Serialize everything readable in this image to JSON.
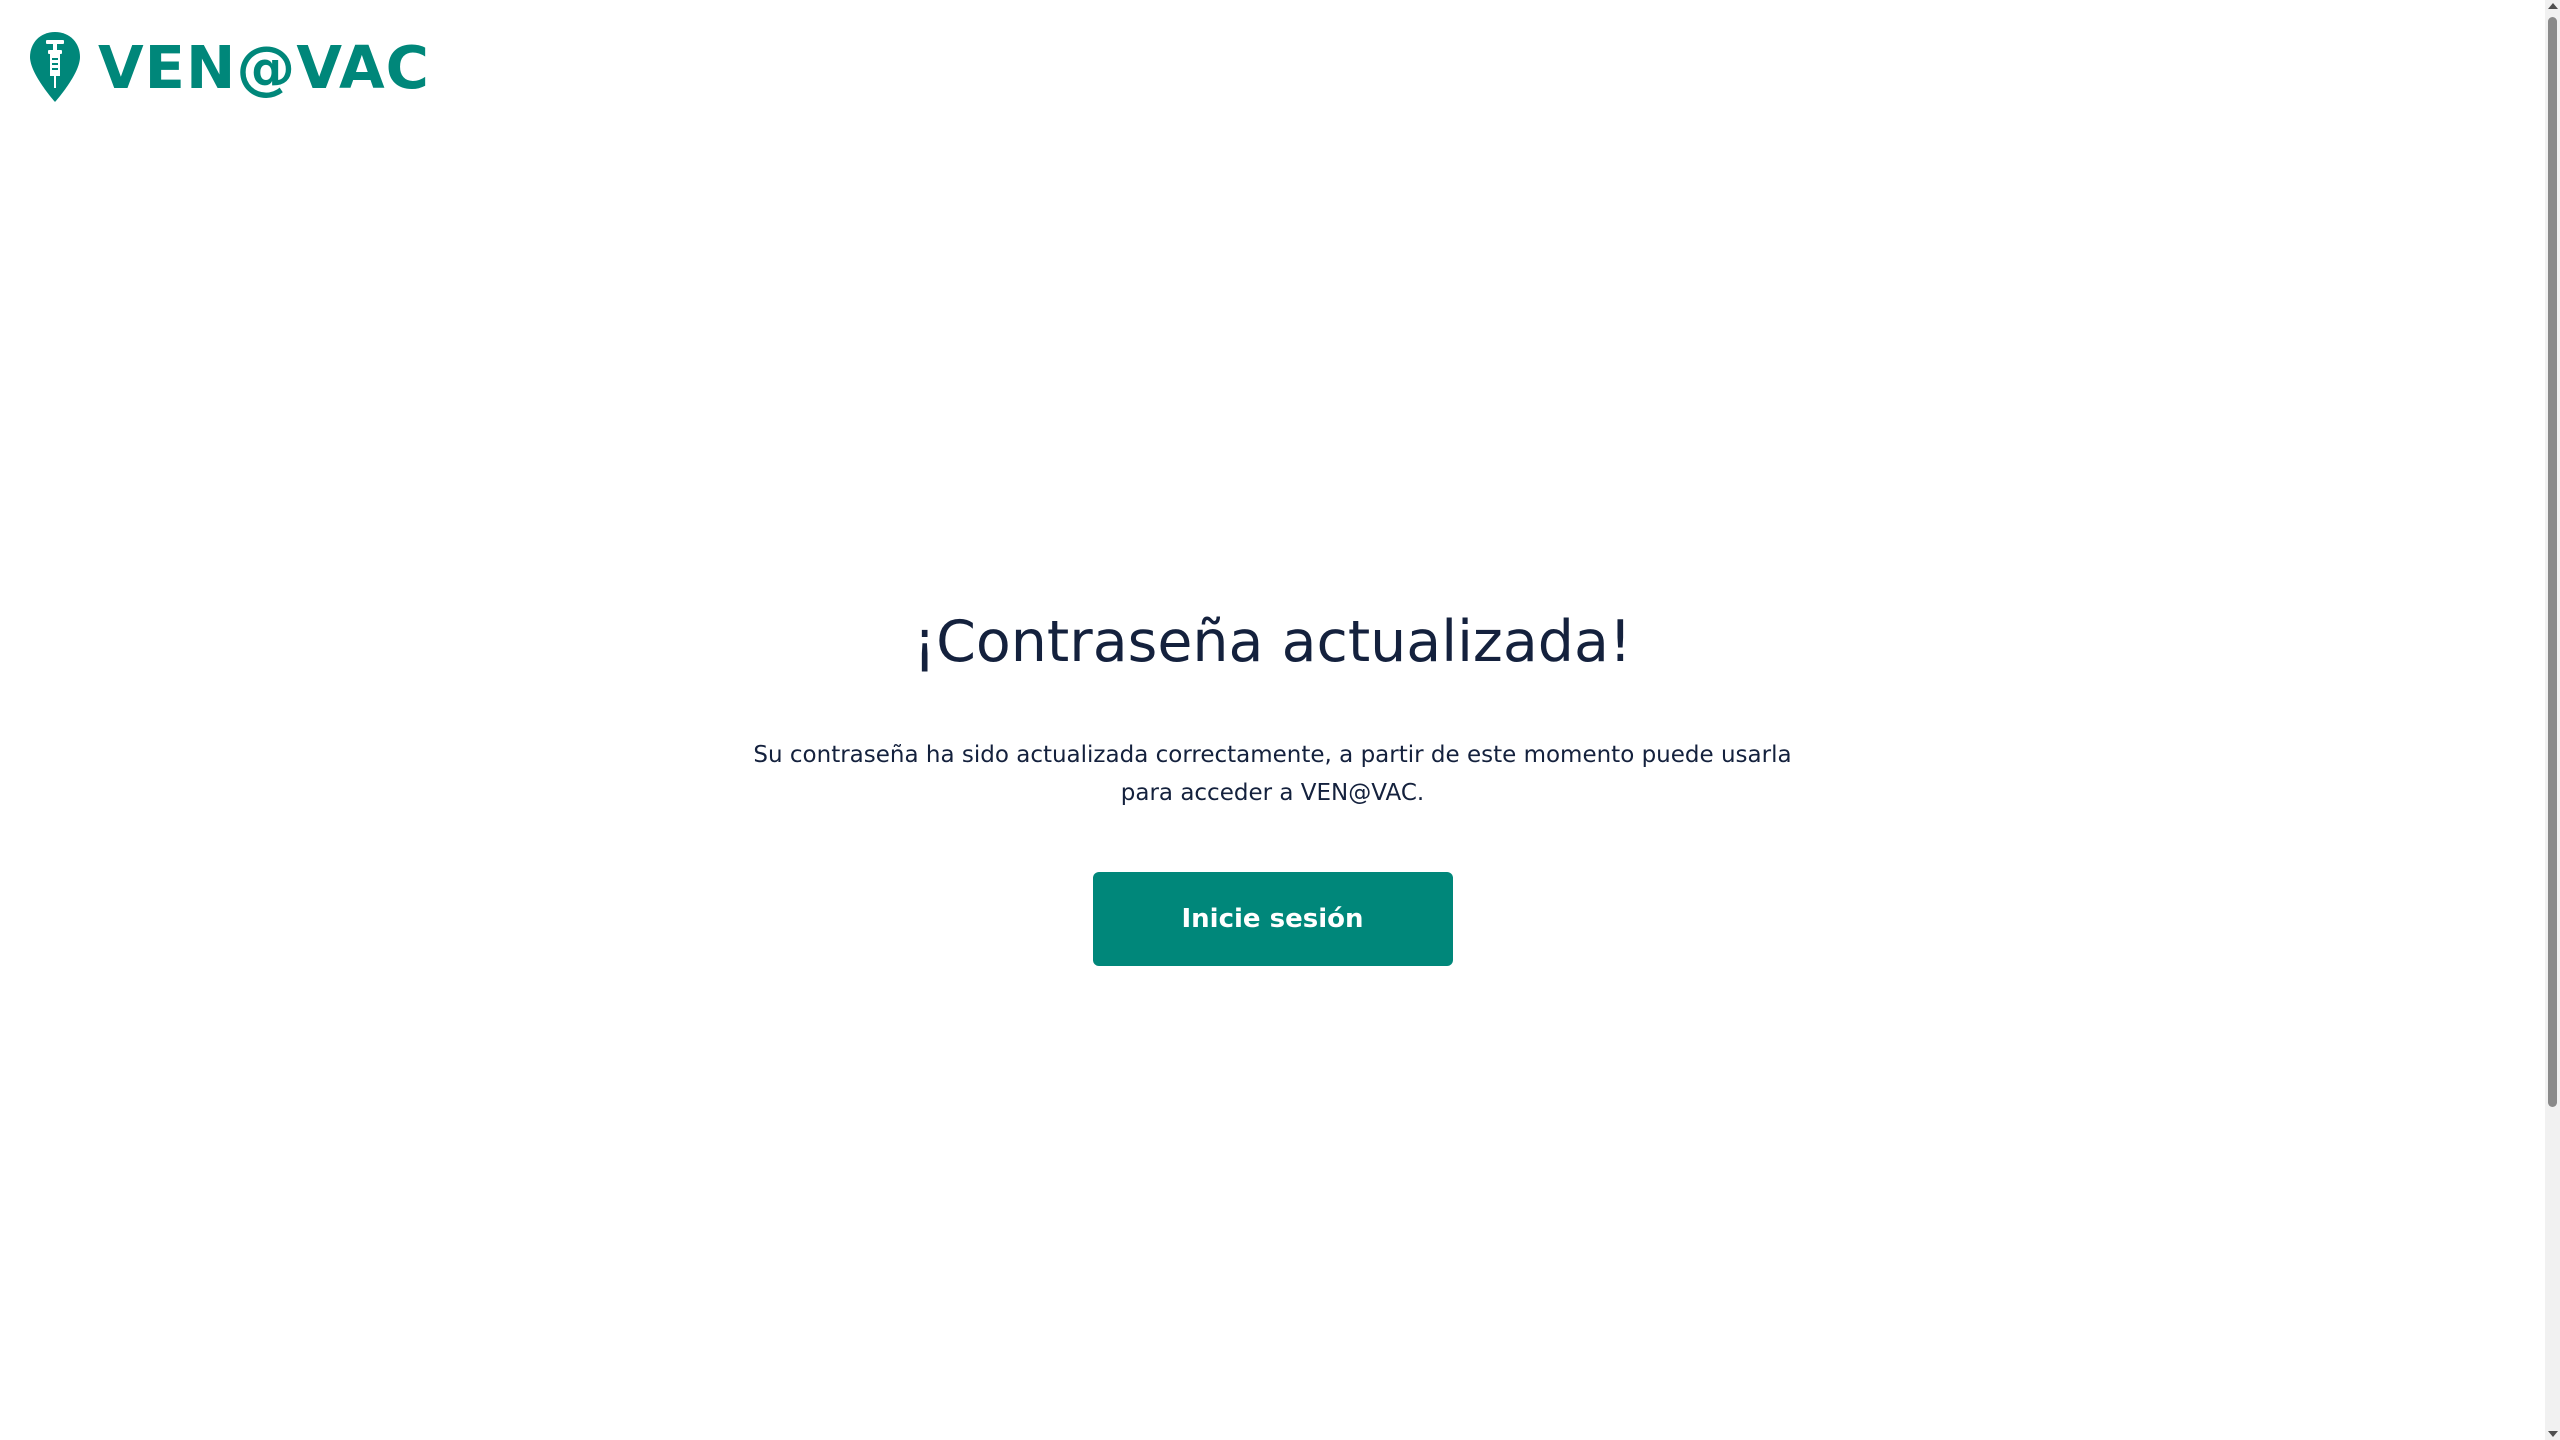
{
  "header": {
    "brand": "VEN@VAC",
    "logo_icon": "vaccine-pin-icon"
  },
  "main": {
    "title": "¡Contraseña actualizada!",
    "message": "Su contraseña ha sido actualizada correctamente, a partir de este momento puede usarla para acceder a VEN@VAC.",
    "login_button_label": "Inicie sesión"
  },
  "colors": {
    "brand": "#00877a",
    "text": "#14213d",
    "background": "#ffffff"
  }
}
